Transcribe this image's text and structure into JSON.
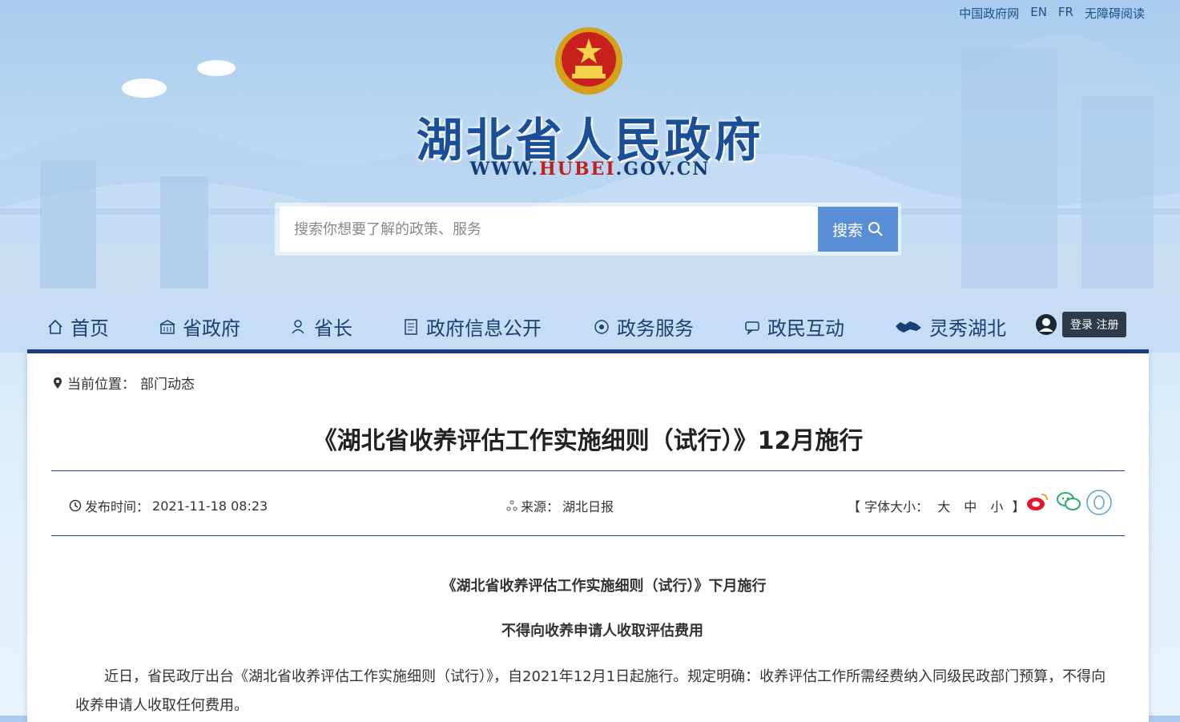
{
  "top_links": [
    "中国政府网",
    "EN",
    "FR",
    "无障碍阅读"
  ],
  "site": {
    "title": "湖北省人民政府",
    "url_prefix": "WWW.",
    "url_brand": "HUBEI",
    "url_suffix": ".GOV.CN"
  },
  "search": {
    "placeholder": "搜索你想要了解的政策、服务",
    "button": "搜索"
  },
  "nav": [
    {
      "label": "首页",
      "icon": "home-icon"
    },
    {
      "label": "省政府",
      "icon": "building-icon"
    },
    {
      "label": "省长",
      "icon": "person-icon"
    },
    {
      "label": "政府信息公开",
      "icon": "document-icon"
    },
    {
      "label": "政务服务",
      "icon": "service-icon"
    },
    {
      "label": "政民互动",
      "icon": "chat-icon"
    },
    {
      "label": "灵秀湖北",
      "icon": "map-icon"
    }
  ],
  "user": {
    "login_register": "登录 注册"
  },
  "breadcrumb": {
    "label": "当前位置：",
    "current": "部门动态"
  },
  "article": {
    "title": "《湖北省收养评估工作实施细则（试行）》12月施行",
    "publish_label": "发布时间：",
    "publish_time": "2021-11-18 08:23",
    "source_label": "来源：",
    "source": "湖北日报",
    "font_size_label": "【 字体大小：",
    "font_sizes": [
      "大",
      "中",
      "小"
    ],
    "font_size_close": "】",
    "subtitle1": "《湖北省收养评估工作实施细则（试行）》下月施行",
    "subtitle2": "不得向收养申请人收取评估费用",
    "paragraph1": "近日，省民政厅出台《湖北省收养评估工作实施细则（试行）》，自2021年12月1日起施行。规定明确：收养评估工作所需经费纳入同级民政部门预算，不得向收养申请人收取任何费用。"
  },
  "colors": {
    "nav_bar": "#1e3f86",
    "search_button": "#5a8fd6",
    "title_blue": "#1a4f97",
    "brand_red": "#c0201c"
  }
}
